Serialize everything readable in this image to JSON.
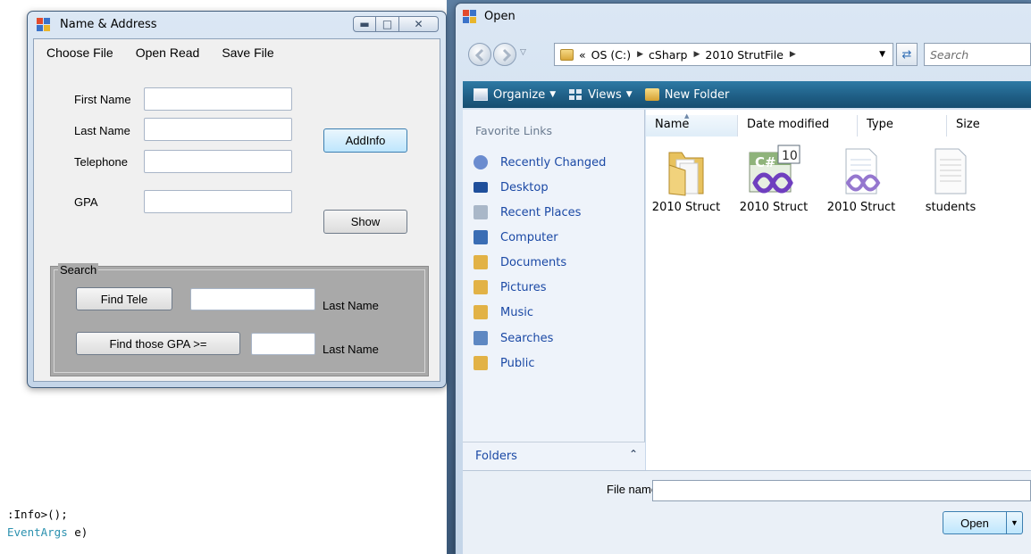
{
  "code": {
    "line1_text": ":Info>();",
    "line2_kw": "EventArgs",
    "line2_rest": " e)"
  },
  "name_window": {
    "title": "Name & Address",
    "menu": [
      "Choose File",
      "Open Read",
      "Save File"
    ],
    "labels": {
      "first_name": "First Name",
      "last_name": "Last Name",
      "telephone": "Telephone",
      "gpa": "GPA"
    },
    "fields": {
      "first_name": "",
      "last_name": "",
      "telephone": "",
      "gpa": ""
    },
    "buttons": {
      "add_info": "AddInfo",
      "show": "Show",
      "find_tele": "Find Tele",
      "find_gpa": "Find those GPA >="
    },
    "search_group": {
      "title": "Search",
      "tele_result_label": "Last Name",
      "gpa_result_label": "Last Name"
    }
  },
  "open_dialog": {
    "title": "Open",
    "address": {
      "prefix": "«",
      "crumbs": [
        "OS (C:)",
        "cSharp",
        "2010 StrutFile"
      ]
    },
    "search_placeholder": "Search",
    "toolbar": {
      "organize": "Organize",
      "views": "Views",
      "new_folder": "New Folder"
    },
    "favorites_title": "Favorite Links",
    "favorites": [
      {
        "label": "Recently Changed",
        "icon": "recently-changed-icon",
        "color": "#6b8ccf"
      },
      {
        "label": "Desktop",
        "icon": "desktop-icon",
        "color": "#1f4f9b"
      },
      {
        "label": "Recent Places",
        "icon": "recent-places-icon",
        "color": "#7a8fa8"
      },
      {
        "label": "Computer",
        "icon": "computer-icon",
        "color": "#3a6db4"
      },
      {
        "label": "Documents",
        "icon": "documents-icon",
        "color": "#e2b246"
      },
      {
        "label": "Pictures",
        "icon": "pictures-icon",
        "color": "#e2b246"
      },
      {
        "label": "Music",
        "icon": "music-icon",
        "color": "#e2b246"
      },
      {
        "label": "Searches",
        "icon": "searches-icon",
        "color": "#5e88c2"
      },
      {
        "label": "Public",
        "icon": "public-icon",
        "color": "#e2b246"
      }
    ],
    "folders_label": "Folders",
    "columns": [
      "Name",
      "Date modified",
      "Type",
      "Size"
    ],
    "files": [
      {
        "name": "2010 Struct",
        "icon": "folder-icon"
      },
      {
        "name": "2010 Struct",
        "icon": "csharp-project-icon",
        "badge": "10"
      },
      {
        "name": "2010 Struct",
        "icon": "solution-file-icon"
      },
      {
        "name": "students",
        "icon": "text-file-icon"
      }
    ],
    "file_name_label": "File name:",
    "file_name_value": "",
    "open_button": "Open"
  }
}
